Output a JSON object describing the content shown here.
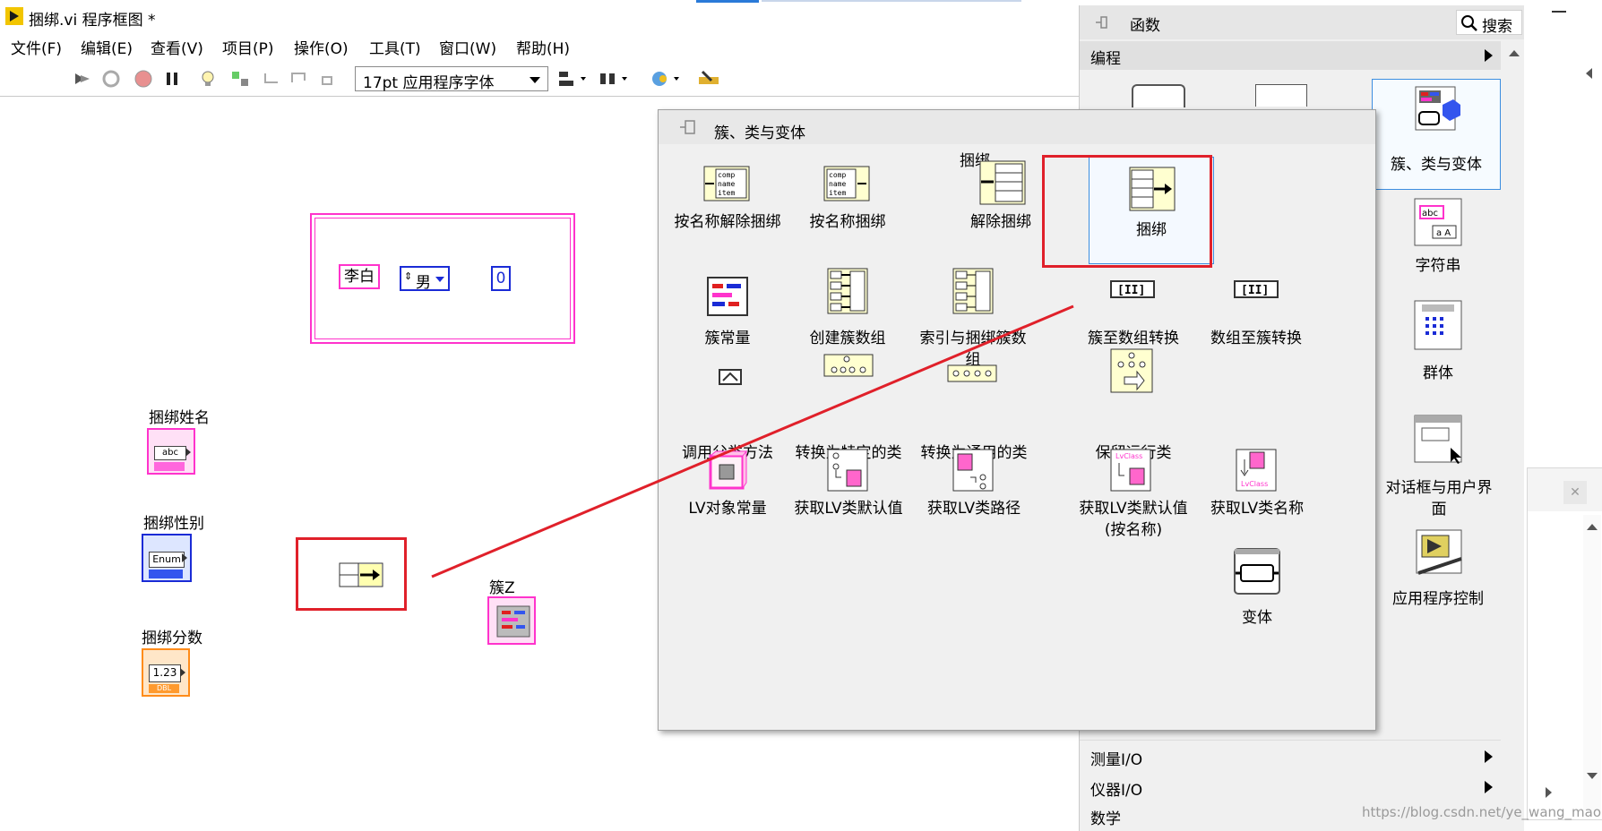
{
  "window": {
    "title": "捆绑.vi 程序框图 *"
  },
  "menu": [
    "文件(F)",
    "编辑(E)",
    "查看(V)",
    "项目(P)",
    "操作(O)",
    "工具(T)",
    "窗口(W)",
    "帮助(H)"
  ],
  "toolbar": {
    "font": "17pt 应用程序字体"
  },
  "diagram": {
    "cluster_const": {
      "name": "李白",
      "enum": "男",
      "number": "0"
    },
    "terminals": {
      "name": "捆绑姓名",
      "gender": "捆绑性别",
      "score": "捆绑分数",
      "cluster": "簇Z"
    },
    "terminal_badges": {
      "name": "abc",
      "gender": "Enum",
      "score": "1.23",
      "score_type": "DBL"
    }
  },
  "functions_palette": {
    "title": "函数",
    "search": "搜索",
    "categories": {
      "programming": "编程",
      "measurement": "测量I/O",
      "instrument": "仪器I/O",
      "math": "数学"
    },
    "items": {
      "cluster_class_variant": "簇、类与变体",
      "string": "字符串",
      "group": "群体",
      "dialog": "对话框与用户界",
      "dialog2": "面",
      "app_control": "应用程序控制"
    }
  },
  "sub_palette": {
    "title": "簇、类与变体",
    "section_label": "捆绑",
    "items": [
      "按名称解除捆绑",
      "按名称捆绑",
      "解除捆绑",
      "捆绑",
      "簇常量",
      "创建簇数组",
      "索引与捆绑簇数",
      "组",
      "簇至数组转换",
      "数组至簇转换",
      "调用父类方法",
      "转换为特定的类",
      "转换为通用的类",
      "保留运行类",
      "LV对象常量",
      "获取LV类默认值",
      "获取LV类路径",
      "获取LV类默认值",
      "(按名称)",
      "获取LV类名称",
      "变体"
    ]
  },
  "watermark": "https://blog.csdn.net/ye_wang_mao",
  "colors": {
    "highlight_red": "#e0202a",
    "cluster_pink": "#ff33cc",
    "enum_blue": "#1a2bd6",
    "dbl_orange": "#ff8c1a",
    "selection_blue": "#3c8ee0"
  }
}
